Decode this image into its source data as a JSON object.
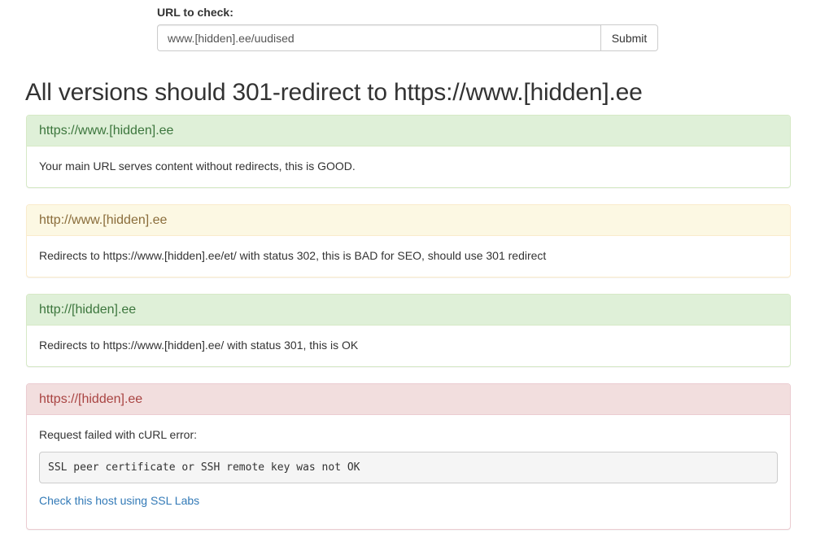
{
  "form": {
    "label": "URL to check:",
    "input_value": "www.[hidden].ee/uudised",
    "submit_label": "Submit"
  },
  "heading": "All versions should 301-redirect to https://www.[hidden].ee",
  "panels": [
    {
      "status": "success",
      "title": "https://www.[hidden].ee",
      "message": "Your main URL serves content without redirects, this is GOOD."
    },
    {
      "status": "warning",
      "title": "http://www.[hidden].ee",
      "message": "Redirects to https://www.[hidden].ee/et/ with status 302, this is BAD for SEO, should use 301 redirect"
    },
    {
      "status": "success",
      "title": "http://[hidden].ee",
      "message": "Redirects to https://www.[hidden].ee/ with status 301, this is OK"
    },
    {
      "status": "danger",
      "title": "https://[hidden].ee",
      "message": "Request failed with cURL error:",
      "error_code": "SSL peer certificate or SSH remote key was not OK",
      "link_text": "Check this host using SSL Labs"
    }
  ],
  "colors": {
    "success_bg": "#dff0d8",
    "success_text": "#3c763d",
    "warning_bg": "#fcf8e3",
    "warning_text": "#8a6d3b",
    "danger_bg": "#f2dede",
    "danger_text": "#a94442",
    "link": "#337ab7"
  }
}
